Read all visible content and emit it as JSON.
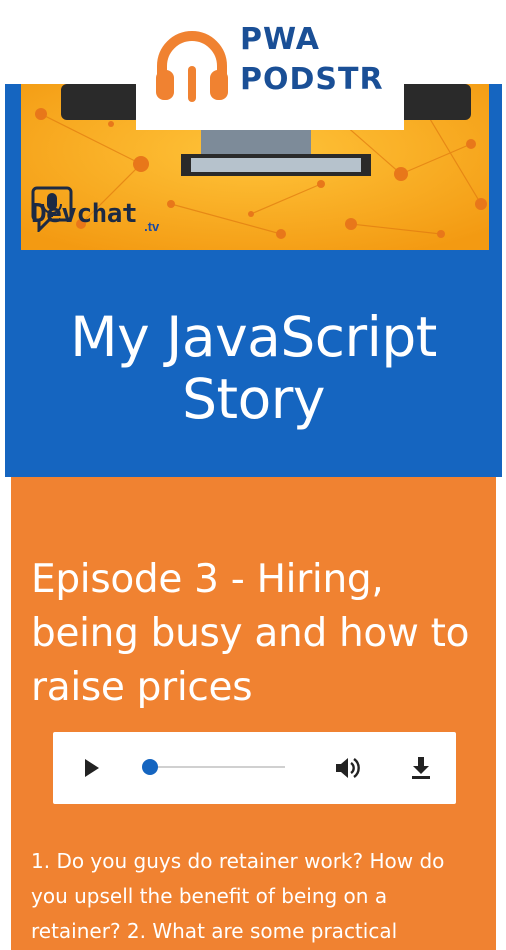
{
  "app": {
    "logo_line1": "PWA",
    "logo_line2": "PODSTR",
    "logo_icon": "headphones-icon",
    "brand_color": "#1a4f96",
    "accent_color": "#f08231"
  },
  "podcast": {
    "title": "My JavaScript Story",
    "cover_brand": "Devchat",
    "cover_brand_suffix": ".tv",
    "cover_color": "#1565c0"
  },
  "episode": {
    "title": "Episode 3 - Hiring, being busy and how to raise prices",
    "description": "1. Do you guys do retainer work? How do you upsell the benefit of being on a retainer? 2. What are some practical"
  },
  "player": {
    "play_icon": "play-icon",
    "volume_icon": "volume-icon",
    "download_icon": "download-icon",
    "progress": 0
  }
}
